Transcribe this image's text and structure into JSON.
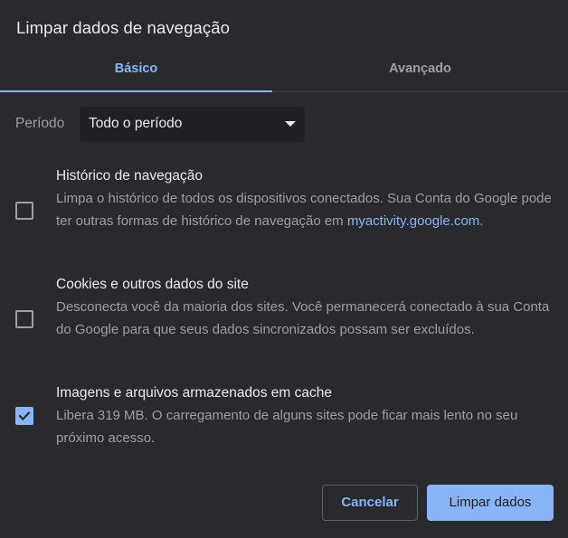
{
  "dialog": {
    "title": "Limpar dados de navegação"
  },
  "tabs": [
    {
      "label": "Básico",
      "active": true
    },
    {
      "label": "Avançado",
      "active": false
    }
  ],
  "period": {
    "label": "Período",
    "value": "Todo o período"
  },
  "items": [
    {
      "title": "Histórico de navegação",
      "description": "Limpa o histórico de todos os dispositivos conectados. Sua Conta do Google pode ter outras formas de histórico de navegação em ",
      "link": "myactivity.google.com",
      "description_end": ".",
      "checked": false
    },
    {
      "title": "Cookies e outros dados do site",
      "description": "Desconecta você da maioria dos sites. Você permanecerá conectado à sua Conta do Google para que seus dados sincronizados possam ser excluídos.",
      "checked": false
    },
    {
      "title": "Imagens e arquivos armazenados em cache",
      "description": "Libera 319 MB. O carregamento de alguns sites pode ficar mais lento no seu próximo acesso.",
      "checked": true
    }
  ],
  "buttons": {
    "cancel": "Cancelar",
    "clear": "Limpar dados"
  },
  "colors": {
    "background": "#292a2d",
    "accent": "#8ab4f8",
    "text_primary": "#e8eaed",
    "text_secondary": "#9aa0a6",
    "select_bg": "#202124"
  },
  "icons": {
    "dropdown": "caret-down-icon",
    "check": "checkmark-icon"
  }
}
